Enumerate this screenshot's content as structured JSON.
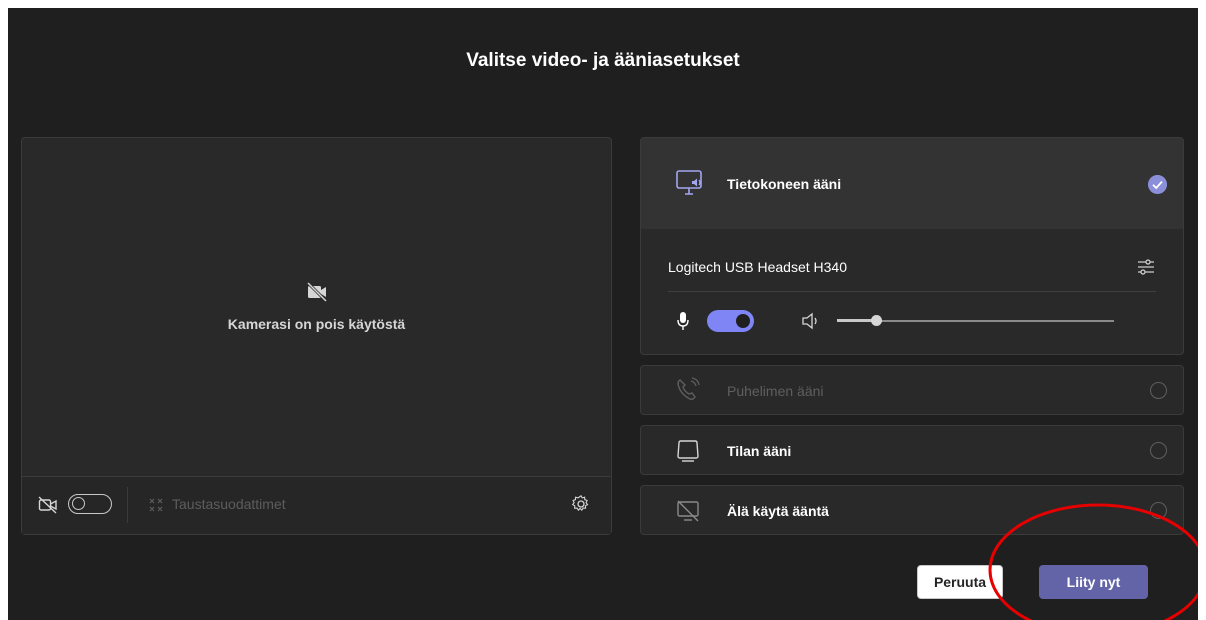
{
  "dialog": {
    "title": "Valitse video- ja ääniasetukset"
  },
  "video": {
    "camera_off_text": "Kamerasi on pois käytöstä",
    "background_filters_label": "Taustasuodattimet",
    "camera_toggle_state": "off"
  },
  "audio": {
    "options": [
      {
        "label": "Tietokoneen ääni",
        "icon": "computer-audio-icon",
        "selected": true,
        "enabled": true
      },
      {
        "label": "Puhelimen ääni",
        "icon": "phone-audio-icon",
        "selected": false,
        "enabled": false
      },
      {
        "label": "Tilan ääni",
        "icon": "room-audio-icon",
        "selected": false,
        "enabled": true
      },
      {
        "label": "Älä käytä ääntä",
        "icon": "no-audio-icon",
        "selected": false,
        "enabled": true
      }
    ],
    "device_name": "Logitech USB Headset H340",
    "mic_toggle_state": "on",
    "speaker_volume": 0.14
  },
  "buttons": {
    "cancel_label": "Peruuta",
    "join_label": "Liity nyt"
  },
  "colors": {
    "accent": "#6264a7",
    "toggle_on": "#7f85f5",
    "annotation_circle": "#e60000"
  }
}
